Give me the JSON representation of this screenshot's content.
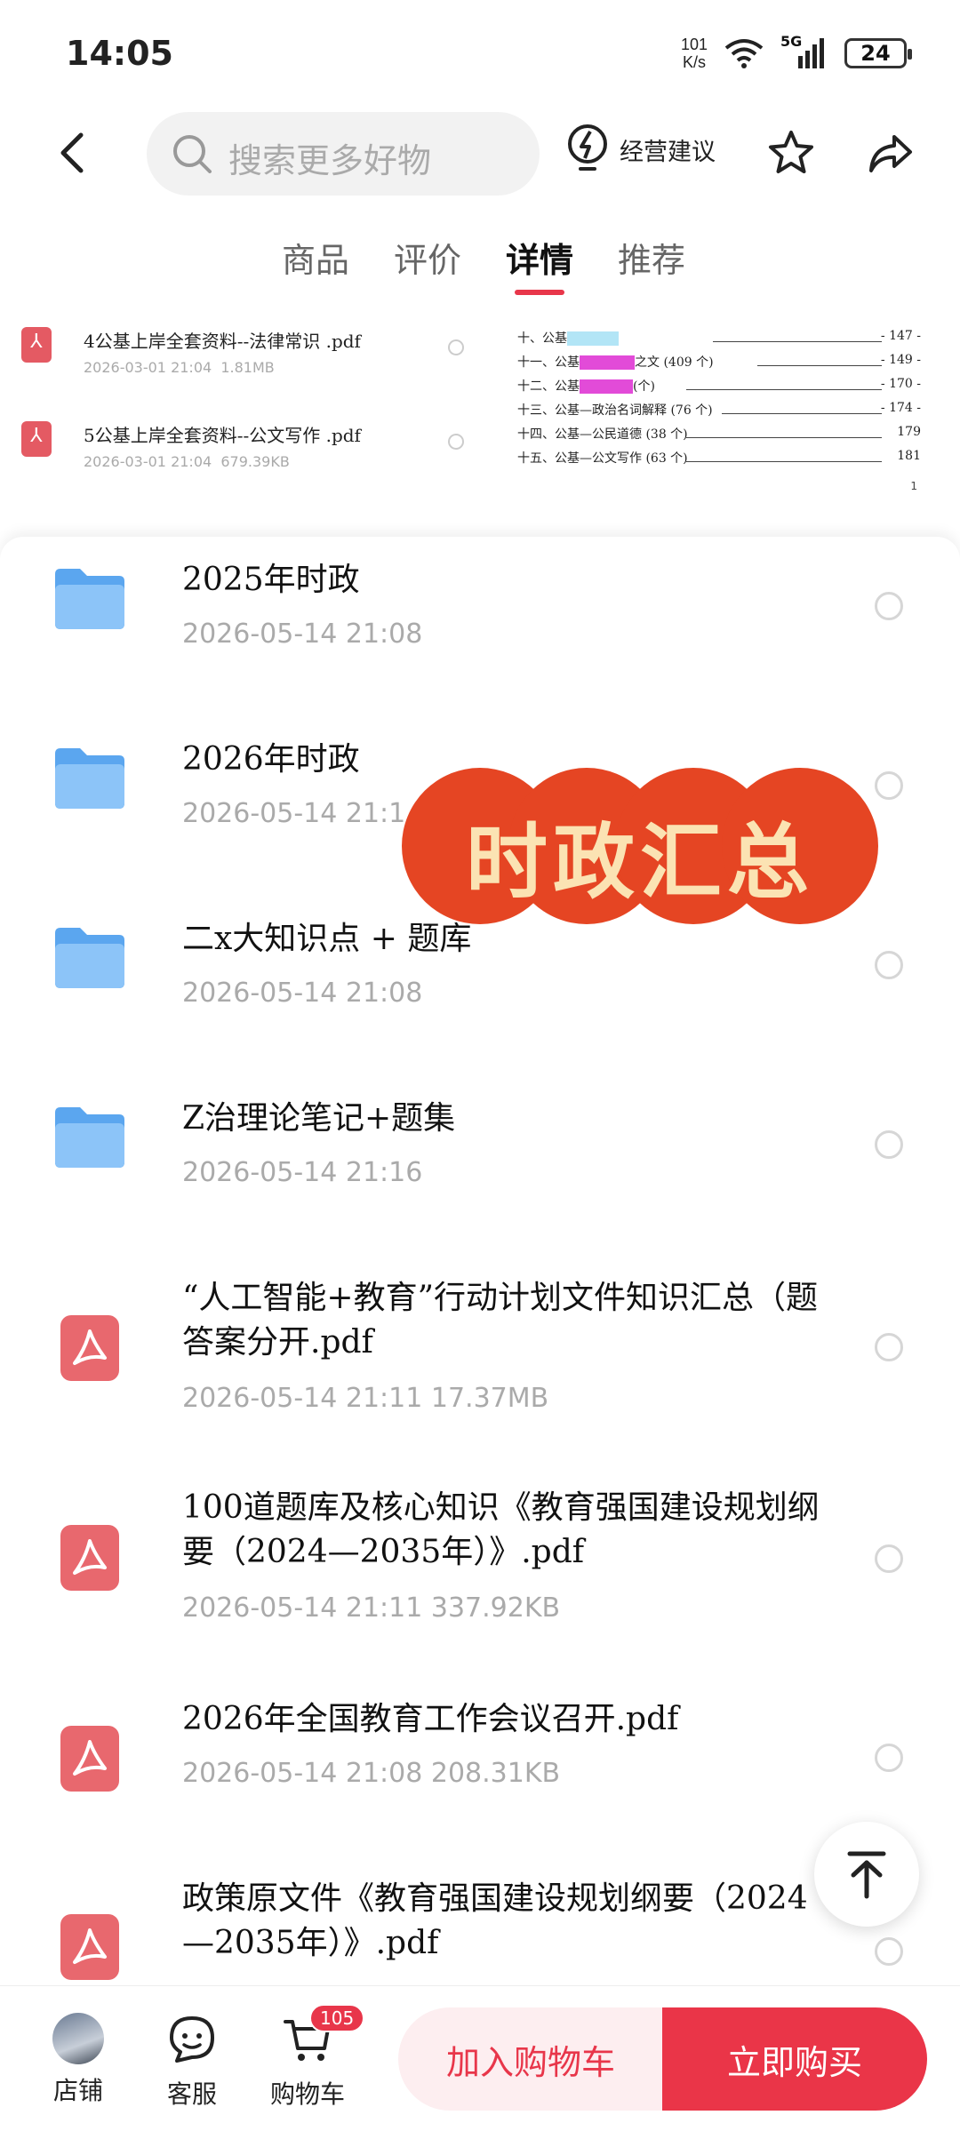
{
  "status_bar": {
    "time": "14:05",
    "net_speed_value": "101",
    "net_speed_unit": "K/s",
    "network": "5G",
    "battery": "24"
  },
  "nav": {
    "search_placeholder": "搜索更多好物",
    "advice_label": "经营建议"
  },
  "tabs": [
    {
      "label": "商品",
      "active": false
    },
    {
      "label": "评价",
      "active": false
    },
    {
      "label": "详情",
      "active": true
    },
    {
      "label": "推荐",
      "active": false
    }
  ],
  "preview": {
    "files": [
      {
        "name": "4公基上岸全套资料--法律常识 .pdf",
        "date": "2026-03-01  21:04",
        "size": "1.81MB"
      },
      {
        "name": "5公基上岸全套资料--公文写作 .pdf",
        "date": "2026-03-01  21:04",
        "size": "679.39KB"
      }
    ],
    "toc": [
      {
        "prefix": "十、公基",
        "suffix": "",
        "page": "- 147 -"
      },
      {
        "prefix": "十一、公基",
        "suffix": "之文 (409 个)",
        "page": "- 149 -"
      },
      {
        "prefix": "十二、公基",
        "suffix": "(个)",
        "page": "- 170 -"
      },
      {
        "prefix": "十三、公基—",
        "suffix": "政治名词解释 (76 个)",
        "page": "- 174 -"
      },
      {
        "prefix": "十四、公基—",
        "suffix": "公民道德 (38 个)",
        "page": "179"
      },
      {
        "prefix": "十五、公基—",
        "suffix": "公文写作 (63 个)",
        "page": "181"
      }
    ],
    "toc_last_page": "1"
  },
  "list": [
    {
      "type": "folder",
      "title": "2025年时政",
      "meta": "2026-05-14  21:08"
    },
    {
      "type": "folder",
      "title": "2026年时政",
      "meta": "2026-05-14  21:1"
    },
    {
      "type": "folder",
      "title": "二x大知识点 + 题库",
      "meta": "2026-05-14  21:08"
    },
    {
      "type": "folder",
      "title": "Z治理论笔记+题集",
      "meta": "2026-05-14  21:16"
    },
    {
      "type": "pdf",
      "title": "“人工智能+教育”行动计划文件知识汇总（题答案分开.pdf",
      "meta": "2026-05-14  21:11  17.37MB"
    },
    {
      "type": "pdf",
      "title": "100道题库及核心知识《教育强国建设规划纲要（2024—2035年）》.pdf",
      "meta": "2026-05-14  21:11  337.92KB"
    },
    {
      "type": "pdf",
      "title": "2026年全国教育工作会议召开.pdf",
      "meta": "2026-05-14  21:08  208.31KB"
    },
    {
      "type": "pdf",
      "title": "政策原文件《教育强国建设规划纲要（2024—2035年）》.pdf",
      "meta": ""
    }
  ],
  "overlay_badge": "时政汇总",
  "bottom_bar": {
    "shop_label": "店铺",
    "service_label": "客服",
    "cart_label": "购物车",
    "cart_count": "105",
    "add_cart_label": "加入购物车",
    "buy_now_label": "立即购买"
  },
  "colors": {
    "accent": "#e8364a",
    "folder": "#6fb3f5",
    "pdf": "#e8686e",
    "badge": "#e54523"
  }
}
